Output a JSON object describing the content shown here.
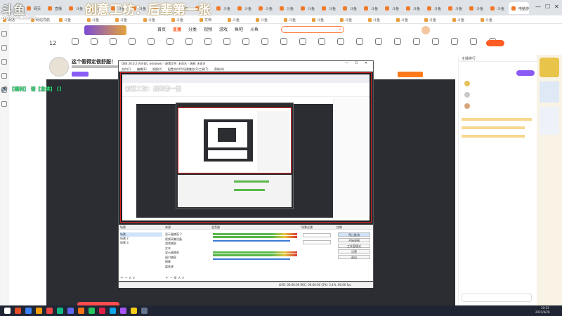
{
  "overlay": {
    "watermark_top": "创意工坊：后辈第一张",
    "watermark_logo": "斗鱼",
    "watermark_url": "DOUYU.COM",
    "scroll_left": "🔊 【福利】 请【念佛】 []",
    "scroll_on_obs": "创意工坊：后辈第一张"
  },
  "browser": {
    "tabs": [
      "网页",
      "直播",
      "斗鱼",
      "斗鱼",
      "斗鱼",
      "斗鱼",
      "斗鱼",
      "斗鱼",
      "斗鱼",
      "斗鱼",
      "斗鱼",
      "斗鱼",
      "斗鱼",
      "斗鱼",
      "斗鱼",
      "斗鱼",
      "斗鱼",
      "斗鱼",
      "斗鱼",
      "斗鱼",
      "斗鱼",
      "斗鱼",
      "斗鱼",
      "电脑游戏直播"
    ],
    "bookmarks": [
      "网络",
      "网站导航",
      "斗鱼",
      "斗鱼",
      "斗鱼",
      "斗鱼",
      "斗鱼",
      "文档",
      "斗鱼",
      "斗鱼",
      "斗鱼",
      "斗鱼",
      "斗鱼",
      "斗鱼",
      "斗鱼",
      "斗鱼",
      "斗鱼",
      "斗鱼"
    ]
  },
  "site": {
    "nav": [
      "首页",
      "直播",
      "分类",
      "视频",
      "游戏",
      "鱼吧",
      "斗鱼"
    ],
    "active_nav": "直播",
    "badge": "12",
    "categories": [
      "",
      "",
      "",
      "",
      "",
      "",
      "",
      "",
      "",
      "",
      "",
      "",
      "",
      "",
      "",
      "",
      "",
      "",
      "",
      "",
      "",
      "",
      ""
    ],
    "login_button": "登录",
    "room_title": "这个假得定很舒服！",
    "follow_button": "关注"
  },
  "right": {
    "panel_title": "主播排行",
    "items": [
      "",
      "",
      "",
      ""
    ]
  },
  "obs": {
    "title": "OBS 26.0.2 (64-bit, windows) - 配置文件: 未命名 - 场景: 未命名",
    "menu": [
      "文件(F)",
      "编辑(E)",
      "视图(V)",
      "配置文件(P)",
      "场景集合(S)",
      "工具(T)",
      "帮助(H)"
    ],
    "docks": [
      "场景",
      "来源",
      "混音器",
      "场景过渡",
      "控制"
    ],
    "scenes": [
      "场景",
      "场景 2",
      "场景 3"
    ],
    "sources": [
      "显示器捕获 2",
      "视频采集设备",
      "游戏捕获",
      "文本",
      "显示器捕获",
      "窗口捕获",
      "图像",
      "媒体源"
    ],
    "controls": [
      "停止推流",
      "开始录制",
      "工作室模式",
      "设置",
      "退出"
    ],
    "status": "LIVE: 00:00:00  REC: 00:00:00  CPU: 3.4%, 60.00 fps"
  },
  "taskbar": {
    "time": "10:53",
    "date": "2021/8/28"
  }
}
